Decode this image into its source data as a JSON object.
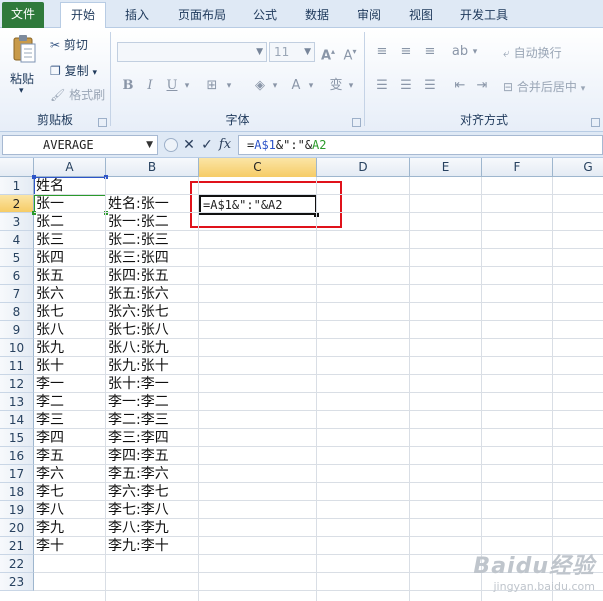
{
  "tabs": [
    {
      "id": "file",
      "label": "文件"
    },
    {
      "id": "home",
      "label": "开始",
      "active": true
    },
    {
      "id": "insert",
      "label": "插入"
    },
    {
      "id": "layout",
      "label": "页面布局"
    },
    {
      "id": "formulas",
      "label": "公式"
    },
    {
      "id": "data",
      "label": "数据"
    },
    {
      "id": "review",
      "label": "审阅"
    },
    {
      "id": "view",
      "label": "视图"
    },
    {
      "id": "developer",
      "label": "开发工具"
    }
  ],
  "ribbon": {
    "clipboard": {
      "paste": "粘贴",
      "cut": "剪切",
      "copy": "复制",
      "format_painter": "格式刷",
      "label": "剪贴板"
    },
    "font": {
      "font_size": "11",
      "bold": "B",
      "italic": "I",
      "underline": "U",
      "label": "字体"
    },
    "alignment": {
      "wrap_text": "自动换行",
      "merge_center": "合并后居中",
      "label": "对齐方式"
    }
  },
  "formula_bar": {
    "name_box": "AVERAGE",
    "cancel": "✕",
    "enter": "✓",
    "fx": "fx",
    "formula_parts": {
      "eq": "=",
      "ref1": "A$1",
      "rest": "&\":\"&",
      "ref2": "A2"
    }
  },
  "columns": [
    "A",
    "B",
    "C",
    "D",
    "E",
    "F",
    "G"
  ],
  "selected_column": "C",
  "rows": [
    "1",
    "2",
    "3",
    "4",
    "5",
    "6",
    "7",
    "8",
    "9",
    "10",
    "11",
    "12",
    "13",
    "14",
    "15",
    "16",
    "17",
    "18",
    "19",
    "20",
    "21",
    "22",
    "23"
  ],
  "selected_row": "2",
  "cells": {
    "A": [
      "姓名",
      "张一",
      "张二",
      "张三",
      "张四",
      "张五",
      "张六",
      "张七",
      "张八",
      "张九",
      "张十",
      "李一",
      "李二",
      "李三",
      "李四",
      "李五",
      "李六",
      "李七",
      "李八",
      "李九",
      "李十"
    ],
    "B": [
      "",
      "姓名:张一",
      "张一:张二",
      "张二:张三",
      "张三:张四",
      "张四:张五",
      "张五:张六",
      "张六:张七",
      "张七:张八",
      "张八:张九",
      "张九:张十",
      "张十:李一",
      "李一:李二",
      "李二:李三",
      "李三:李四",
      "李四:李五",
      "李五:李六",
      "李六:李七",
      "李七:李八",
      "李八:李九",
      "李九:李十"
    ]
  },
  "edit_cell": {
    "address": "C2",
    "value": "=A$1&\":\"&A2"
  },
  "watermark": {
    "main": "Baidu经验",
    "sub": "jingyan.baidu.com"
  }
}
